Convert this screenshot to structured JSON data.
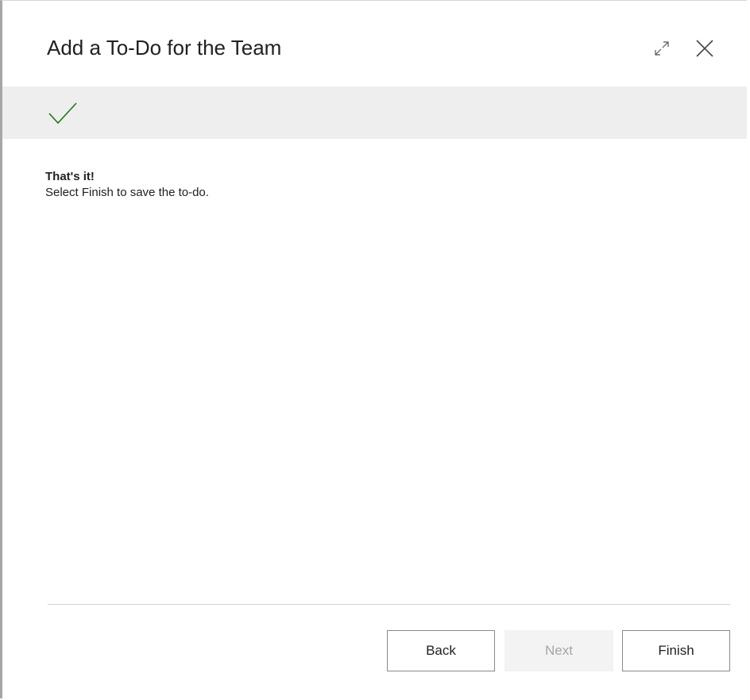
{
  "dialog": {
    "title": "Add a To-Do for the Team",
    "expand_icon": "expand-icon",
    "close_icon": "close-icon"
  },
  "step": {
    "status_icon": "checkmark-icon",
    "status_color": "#107c10"
  },
  "content": {
    "heading": "That's it!",
    "description": "Select Finish to save the to-do."
  },
  "footer": {
    "back_label": "Back",
    "next_label": "Next",
    "finish_label": "Finish",
    "next_disabled": true
  }
}
